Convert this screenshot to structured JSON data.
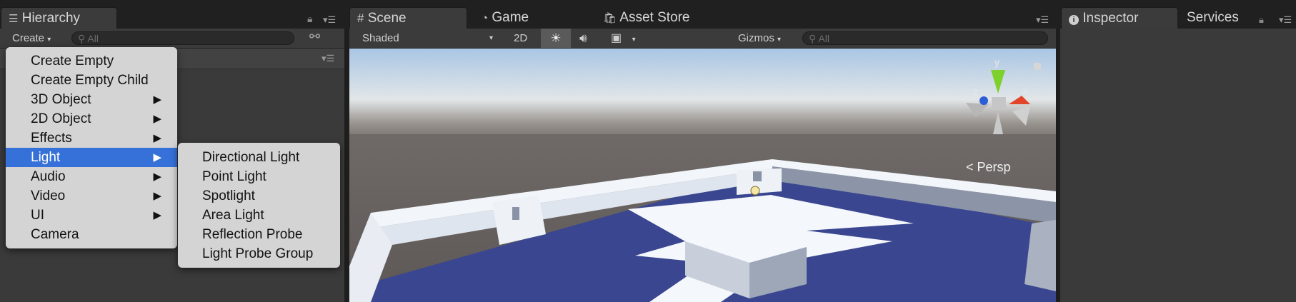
{
  "hierarchy": {
    "tab_label": "Hierarchy",
    "create_label": "Create",
    "search_placeholder": "All"
  },
  "scene_tabs": [
    {
      "label": "Scene"
    },
    {
      "label": "Game"
    },
    {
      "label": "Asset Store"
    }
  ],
  "scene_toolbar": {
    "shading_mode": "Shaded",
    "mode_2d": "2D",
    "gizmos_label": "Gizmos",
    "search_placeholder": "All"
  },
  "scene_view": {
    "projection_label": "Persp",
    "axis_labels": {
      "x": "x",
      "y": "y",
      "z": "z"
    }
  },
  "inspector_tabs": [
    {
      "label": "Inspector"
    },
    {
      "label": "Services"
    }
  ],
  "create_menu": {
    "items": [
      {
        "label": "Create Empty",
        "submenu": false
      },
      {
        "label": "Create Empty Child",
        "submenu": false
      },
      {
        "label": "3D Object",
        "submenu": true
      },
      {
        "label": "2D Object",
        "submenu": true
      },
      {
        "label": "Effects",
        "submenu": true
      },
      {
        "label": "Light",
        "submenu": true,
        "selected": true
      },
      {
        "label": "Audio",
        "submenu": true
      },
      {
        "label": "Video",
        "submenu": true
      },
      {
        "label": "UI",
        "submenu": true
      },
      {
        "label": "Camera",
        "submenu": false
      }
    ],
    "arrow_glyph": "▶"
  },
  "light_submenu": {
    "items": [
      {
        "label": "Directional Light"
      },
      {
        "label": "Point Light"
      },
      {
        "label": "Spotlight"
      },
      {
        "label": "Area Light"
      },
      {
        "label": "Reflection Probe"
      },
      {
        "label": "Light Probe Group"
      }
    ]
  },
  "colors": {
    "selection_blue": "#3571d8",
    "floor_blue": "#3a4790",
    "panel_dark": "#3a3a3a"
  }
}
